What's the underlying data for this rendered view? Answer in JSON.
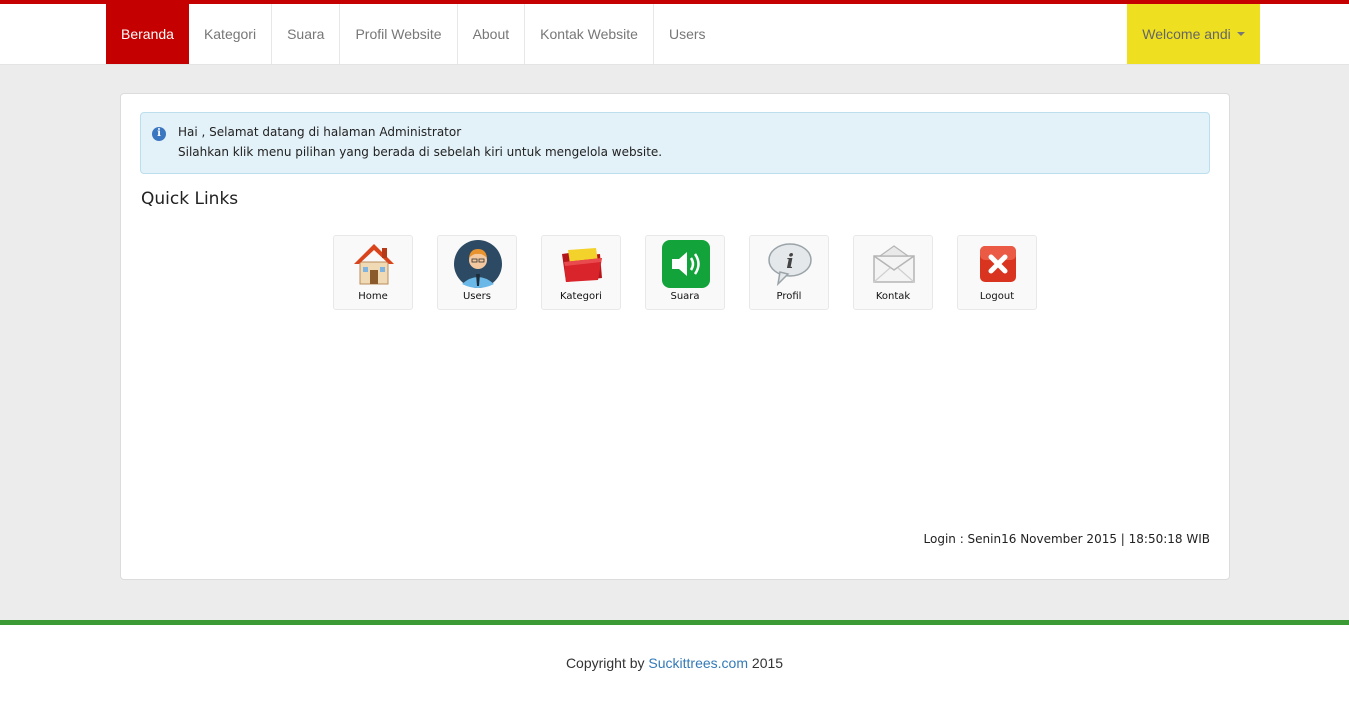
{
  "nav": {
    "items": [
      {
        "label": "Beranda",
        "active": true
      },
      {
        "label": "Kategori"
      },
      {
        "label": "Suara"
      },
      {
        "label": "Profil Website"
      },
      {
        "label": "About"
      },
      {
        "label": "Kontak Website"
      },
      {
        "label": "Users"
      }
    ],
    "welcome": "Welcome andi",
    "accent_color": "#c40000",
    "welcome_color": "#eee020"
  },
  "alert": {
    "line1": "Hai , Selamat datang di halaman Administrator",
    "line2": "Silahkan klik menu pilihan yang berada di sebelah kiri untuk mengelola website.",
    "icon": "info-icon"
  },
  "quick_links": {
    "title": "Quick Links",
    "items": [
      {
        "label": "Home",
        "icon": "house-icon"
      },
      {
        "label": "Users",
        "icon": "user-avatar-icon"
      },
      {
        "label": "Kategori",
        "icon": "folder-icon"
      },
      {
        "label": "Suara",
        "icon": "speaker-icon"
      },
      {
        "label": "Profil",
        "icon": "info-bubble-icon"
      },
      {
        "label": "Kontak",
        "icon": "envelope-icon"
      },
      {
        "label": "Logout",
        "icon": "close-x-icon"
      }
    ]
  },
  "login_info": "Login : Senin16 November 2015 | 18:50:18 WIB",
  "footer": {
    "prefix": "Copyright by ",
    "link": "Suckittrees.com",
    "suffix": " 2015",
    "line_color": "#3c9a34"
  }
}
